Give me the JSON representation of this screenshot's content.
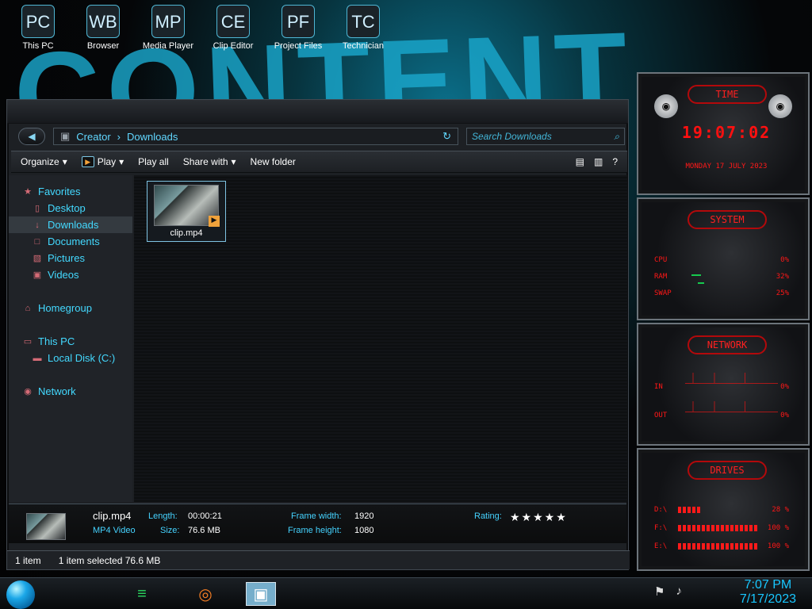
{
  "desktop": {
    "wallpaper_text": "CONTENT",
    "icons": [
      {
        "label": "This PC",
        "icon": "PC"
      },
      {
        "label": "Browser",
        "icon": "WB"
      },
      {
        "label": "Media Player",
        "icon": "MP"
      },
      {
        "label": "Clip Editor",
        "icon": "CE"
      },
      {
        "label": "Project Files",
        "icon": "PF"
      },
      {
        "label": "Technician",
        "icon": "TC"
      }
    ]
  },
  "explorer": {
    "breadcrumbs": [
      "Creator",
      "Downloads"
    ],
    "search_placeholder": "Search Downloads",
    "toolbar": {
      "organize": "Organize",
      "play": "Play",
      "play_all": "Play all",
      "share_with": "Share with",
      "new_folder": "New folder"
    },
    "nav": {
      "favorites": "Favorites",
      "desktop": "Desktop",
      "downloads": "Downloads",
      "documents": "Documents",
      "pictures": "Pictures",
      "videos": "Videos",
      "homegroup": "Homegroup",
      "this_pc": "This PC",
      "local_disk": "Local Disk (C:)",
      "network": "Network"
    },
    "file": {
      "name": "clip.mp4",
      "type": "MP4 Video",
      "length_label": "Length:",
      "length": "00:00:21",
      "size_label": "Size:",
      "size": "76.6 MB",
      "frame_width_label": "Frame width:",
      "frame_width": "1920",
      "frame_height_label": "Frame height:",
      "frame_height": "1080",
      "rating_label": "Rating:",
      "rating_stars": "★★★★★"
    },
    "status": {
      "count": "1 item",
      "selection": "1 item selected 76.6 MB"
    }
  },
  "gadgets": {
    "time": {
      "title": "TIME",
      "clock": "19:07:02",
      "date": "MONDAY 17 JULY 2023"
    },
    "system": {
      "title": "SYSTEM",
      "cpu": "CPU",
      "cpu_value": "0%",
      "ram": "RAM",
      "ram_value": "32%",
      "swap": "SWAP",
      "swap_value": "25%"
    },
    "network": {
      "title": "NETWORK",
      "in": "IN",
      "in_value": "0%",
      "out": "OUT",
      "out_value": "0%"
    },
    "drives": {
      "title": "DRIVES",
      "d1": "D:\\",
      "d1_value": "28 %",
      "d2": "F:\\",
      "d2_value": "100 %",
      "d3": "E:\\",
      "d3_value": "100 %"
    }
  },
  "taskbar": {
    "time": "7:07 PM",
    "date": "7/17/2023"
  },
  "colors": {
    "accent": "#41d7ff",
    "gadget_red": "#ff1717",
    "panel": "#1d2024"
  }
}
